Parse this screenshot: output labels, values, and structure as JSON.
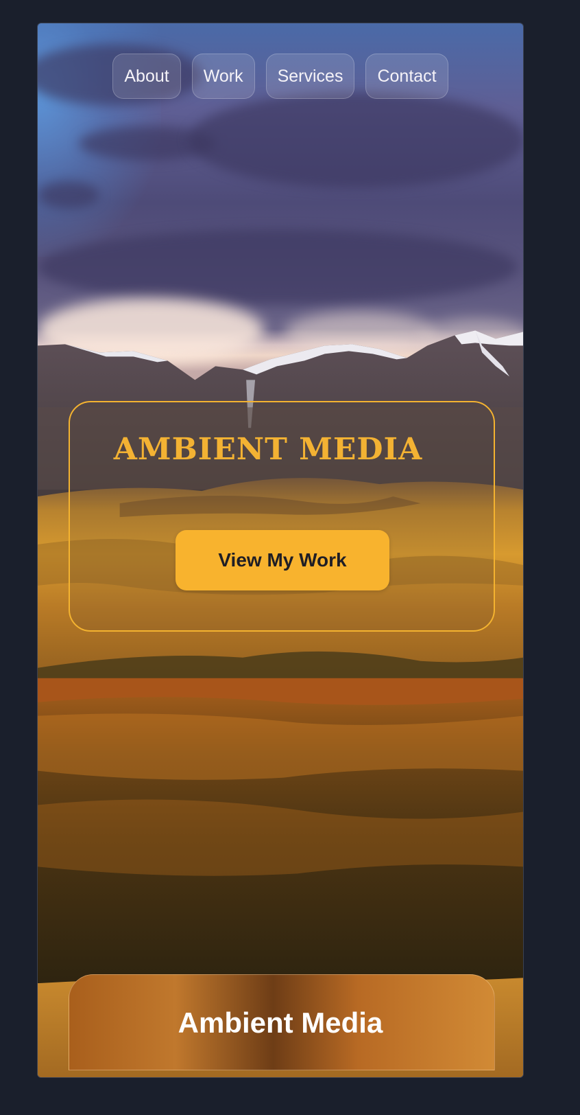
{
  "nav": {
    "items": [
      {
        "label": "About"
      },
      {
        "label": "Work"
      },
      {
        "label": "Services"
      },
      {
        "label": "Contact"
      }
    ]
  },
  "hero": {
    "title": "AMBIENT MEDIA",
    "cta_label": "View My Work"
  },
  "footer": {
    "title": "Ambient Media"
  },
  "colors": {
    "accent": "#f8b32e",
    "page_background": "#1a1f2c"
  },
  "background_image": "mountain valley landscape at sunset"
}
